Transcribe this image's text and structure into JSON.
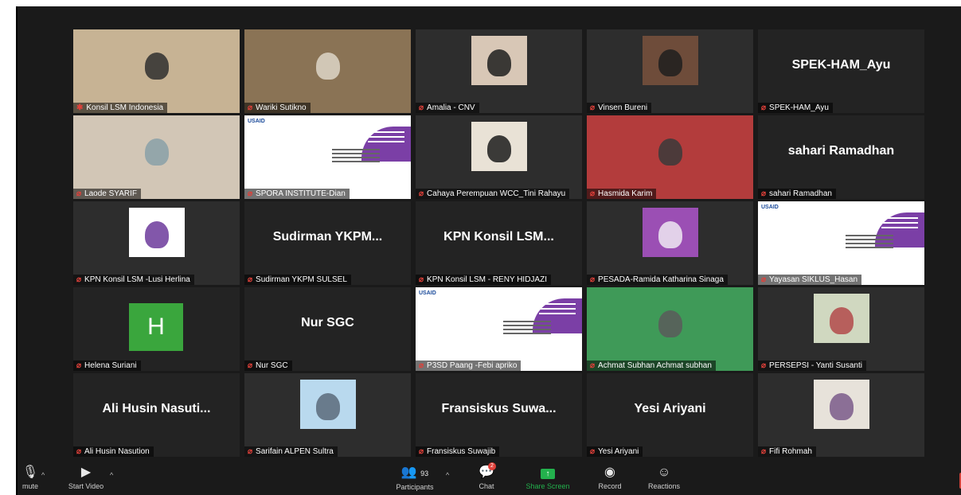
{
  "participants": [
    {
      "name": "Konsil LSM Indonesia",
      "visual": "photo"
    },
    {
      "name": "Wariki Sutikno",
      "visual": "photo"
    },
    {
      "name": "Amalia - CNV",
      "visual": "photo"
    },
    {
      "name": "Vinsen Bureni",
      "visual": "photo"
    },
    {
      "name": "SPEK-HAM_Ayu",
      "visual": "name",
      "display": "SPEK-HAM_Ayu"
    },
    {
      "name": "Laode SYARIF",
      "visual": "photo"
    },
    {
      "name": "SPORA INSTITUTE-Dian",
      "visual": "slide"
    },
    {
      "name": "Cahaya Perempuan WCC_Tini Rahayu",
      "visual": "photo"
    },
    {
      "name": "Hasmida Karim",
      "visual": "photo"
    },
    {
      "name": "sahari Ramadhan",
      "visual": "name",
      "display": "sahari Ramadhan"
    },
    {
      "name": "KPN Konsil LSM -Lusi Herlina",
      "visual": "photo"
    },
    {
      "name": "Sudirman YKPM SULSEL",
      "visual": "name",
      "display": "Sudirman YKPM..."
    },
    {
      "name": "KPN Konsil LSM - RENY HIDJAZI",
      "visual": "name",
      "display": "KPN Konsil LSM..."
    },
    {
      "name": "PESADA-Ramida Katharina Sinaga",
      "visual": "photo"
    },
    {
      "name": "Yayasan SIKLUS_Hasan",
      "visual": "slide"
    },
    {
      "name": "Helena Suriani",
      "visual": "avatar",
      "initial": "H"
    },
    {
      "name": "Nur SGC",
      "visual": "name",
      "display": "Nur SGC"
    },
    {
      "name": "P3SD Paang -Febi apriko",
      "visual": "slide"
    },
    {
      "name": "Achmat Subhan Achmat subhan",
      "visual": "photo"
    },
    {
      "name": "PERSEPSI - Yanti Susanti",
      "visual": "photo"
    },
    {
      "name": "Ali Husin Nasution",
      "visual": "name",
      "display": "Ali Husin Nasuti..."
    },
    {
      "name": "Sarifain ALPEN Sultra",
      "visual": "photo"
    },
    {
      "name": "Fransiskus Suwajib",
      "visual": "name",
      "display": "Fransiskus Suwa..."
    },
    {
      "name": "Yesi Ariyani",
      "visual": "name",
      "display": "Yesi Ariyani"
    },
    {
      "name": "Fifi Rohmah",
      "visual": "photo"
    }
  ],
  "toolbar": {
    "mute_label": "mute",
    "start_video_label": "Start Video",
    "participants_label": "Participants",
    "participants_count": "93",
    "chat_label": "Chat",
    "chat_badge": "2",
    "share_screen_label": "Share Screen",
    "record_label": "Record",
    "reactions_label": "Reactions"
  },
  "colors": {
    "active_border": "#9cd53d",
    "mic_muted": "#e0413a",
    "share": "#23b14d",
    "avatar_h": "#3aa63d",
    "chat_badge": "#e0413a"
  }
}
